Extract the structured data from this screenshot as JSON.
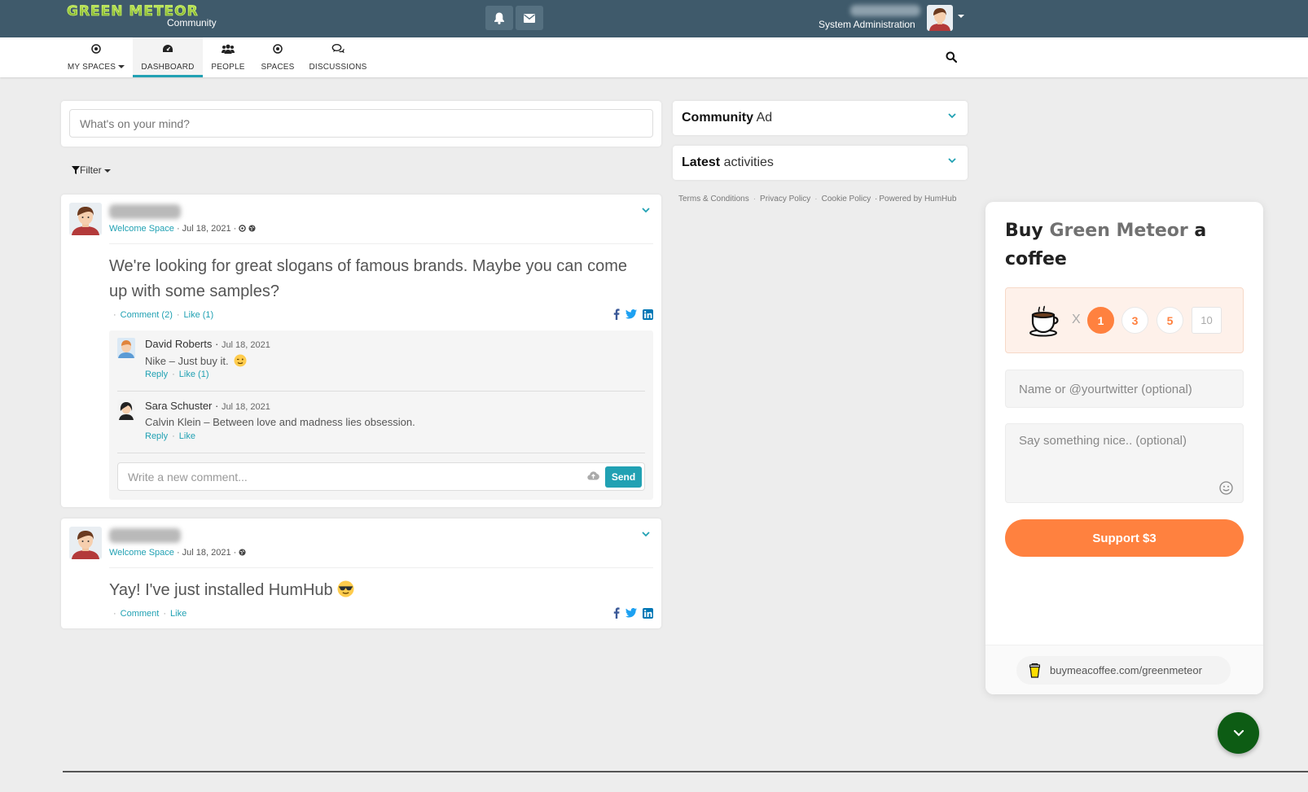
{
  "brand": {
    "logo_text": "GREEN METEOR",
    "subtitle": "Community"
  },
  "header": {
    "user_role": "System Administration"
  },
  "nav": [
    {
      "label": "MY SPACES",
      "icon": "circle-dot-icon"
    },
    {
      "label": "DASHBOARD",
      "icon": "dashboard-icon"
    },
    {
      "label": "PEOPLE",
      "icon": "people-icon"
    },
    {
      "label": "SPACES",
      "icon": "circle-dot-icon"
    },
    {
      "label": "DISCUSSIONS",
      "icon": "chat-bubbles-icon"
    }
  ],
  "composer": {
    "placeholder": "What's on your mind?"
  },
  "filter": {
    "label": "Filter"
  },
  "posts": [
    {
      "space": "Welcome Space",
      "date": "Jul 18, 2021",
      "text": "We're looking for great slogans of famous brands. Maybe you can come up with some samples?",
      "comment_label": "Comment (2)",
      "like_label": "Like (1)",
      "comments": [
        {
          "author": "David Roberts",
          "date": "Jul 18, 2021",
          "text": "Nike – Just buy it.",
          "reply": "Reply",
          "like": "Like (1)"
        },
        {
          "author": "Sara Schuster",
          "date": "Jul 18, 2021",
          "text": "Calvin Klein – Between love and madness lies obsession.",
          "reply": "Reply",
          "like": "Like"
        }
      ],
      "comment_placeholder": "Write a new comment...",
      "send_label": "Send"
    },
    {
      "space": "Welcome Space",
      "date": "Jul 18, 2021",
      "text": "Yay! I've just installed HumHub",
      "comment_label": "Comment",
      "like_label": "Like"
    }
  ],
  "sidebar": {
    "community_ad": {
      "bold": "Community",
      "rest": "Ad"
    },
    "latest": {
      "bold": "Latest",
      "rest": "activities"
    },
    "footer": [
      "Terms & Conditions",
      "Privacy Policy",
      "Cookie Policy",
      "Powered by HumHub"
    ]
  },
  "bmc": {
    "title_pre": "Buy",
    "title_accent": "Green Meteor",
    "title_post": "a coffee",
    "multiplier": "X",
    "quantities": [
      "1",
      "3",
      "5"
    ],
    "selected_quantity": "1",
    "custom_quantity": "10",
    "name_placeholder": "Name or @yourtwitter (optional)",
    "message_placeholder": "Say something nice.. (optional)",
    "support_label": "Support $3",
    "link": "buymeacoffee.com/greenmeteor",
    "accent_color": "#ff813f"
  },
  "colors": {
    "topbar": "#3f5a6b",
    "link": "#21a1b3",
    "fab": "#0d5c14"
  }
}
